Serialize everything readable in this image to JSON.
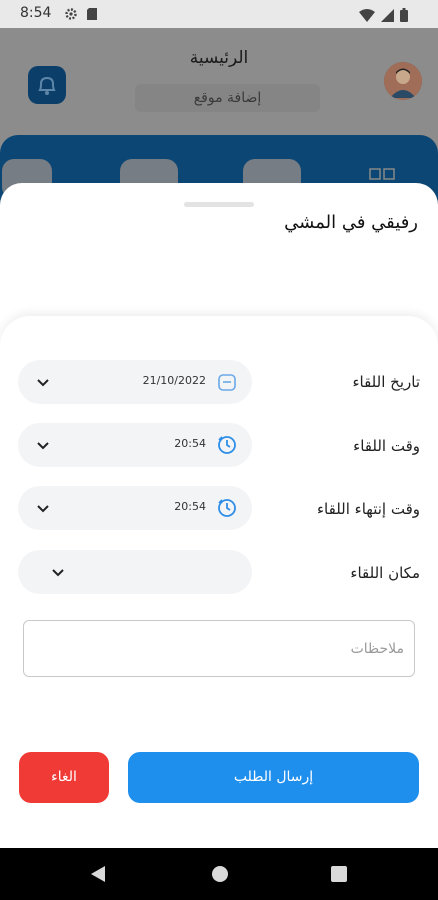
{
  "status_bar": {
    "time": "8:54"
  },
  "background": {
    "title": "الرئيسية",
    "subtitle": "إضافة موقع"
  },
  "sheet": {
    "title": "رفيقي في المشي"
  },
  "form": {
    "date": {
      "label": "تاريخ اللقاء",
      "value": "21/10/2022"
    },
    "start_time": {
      "label": "وقت اللقاء",
      "value": "20:54"
    },
    "end_time": {
      "label": "وقت إنتهاء اللقاء",
      "value": "20:54"
    },
    "location": {
      "label": "مكان اللقاء",
      "value": ""
    },
    "notes": {
      "placeholder": "ملاحظات",
      "value": ""
    }
  },
  "actions": {
    "submit_label": "إرسال الطلب",
    "cancel_label": "الغاء"
  },
  "colors": {
    "accent": "#1f8fee",
    "danger": "#f03a35",
    "field_bg": "#f3f4f6"
  }
}
